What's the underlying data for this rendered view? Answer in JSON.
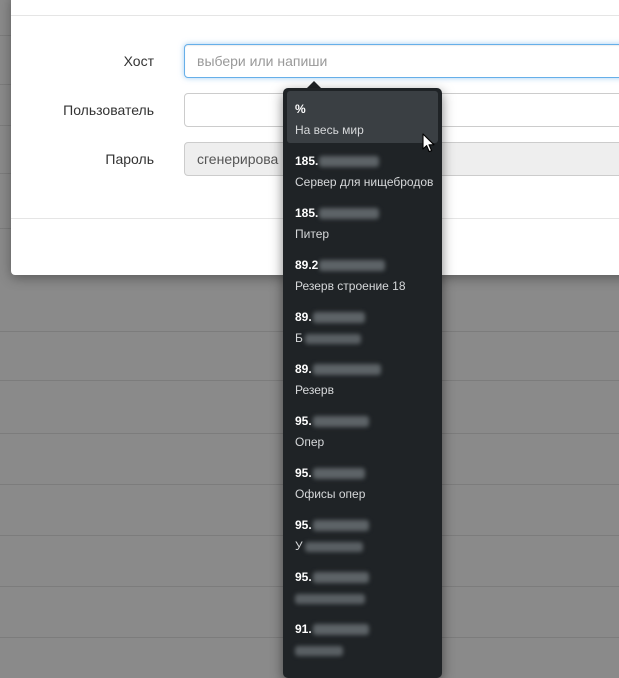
{
  "form": {
    "host_label": "Хост",
    "host_placeholder": "выбери или напиши",
    "user_label": "Пользователь",
    "user_value": "",
    "password_label": "Пароль",
    "password_value": "сгенерирова"
  },
  "dropdown": {
    "items": [
      {
        "ip": "%",
        "desc": "На весь мир"
      },
      {
        "ip": "185.",
        "desc": "Сервер для нищебродов"
      },
      {
        "ip": "185.",
        "desc": "Питер"
      },
      {
        "ip": "89.2",
        "desc": "Резерв строение 18"
      },
      {
        "ip": "89.",
        "desc": "Б"
      },
      {
        "ip": "89.",
        "desc": "Резерв"
      },
      {
        "ip": "95.",
        "desc": "Опер"
      },
      {
        "ip": "95.",
        "desc": "Офисы опер"
      },
      {
        "ip": "95.",
        "desc": "У"
      },
      {
        "ip": "95.",
        "desc": ""
      },
      {
        "ip": "91.",
        "desc": ""
      }
    ]
  },
  "colors": {
    "dropdown_bg": "#1f2326",
    "active_item_bg": "#3a3f43",
    "focus_border": "#66afe9"
  },
  "icons": {
    "cursor": "mouse-pointer-icon"
  }
}
